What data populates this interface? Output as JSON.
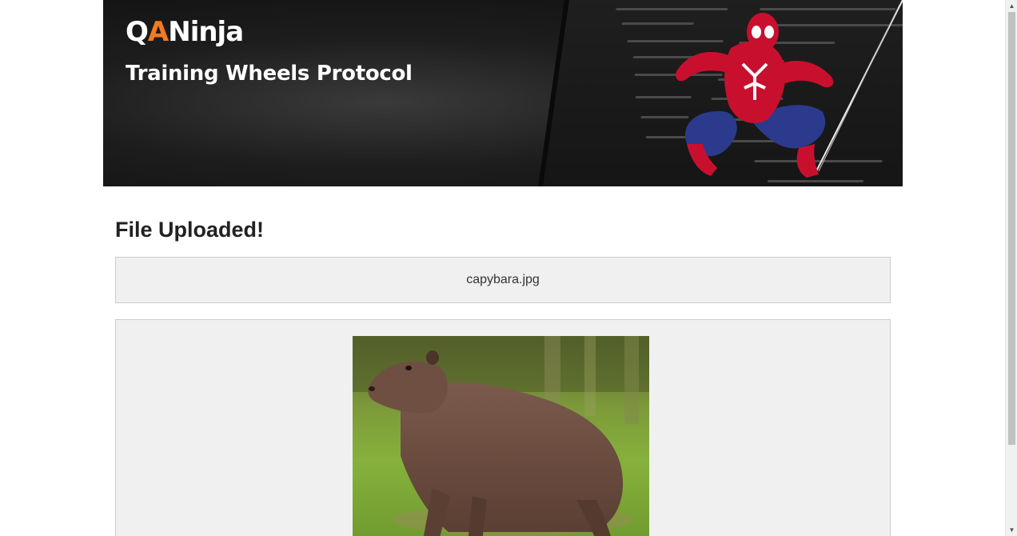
{
  "banner": {
    "logo_qa_q": "Q",
    "logo_qa_a": "A",
    "logo_ninja": "Ninja",
    "title": "Training Wheels Protocol",
    "accent_color": "#f47a1f"
  },
  "main": {
    "heading": "File Uploaded!",
    "uploaded_file_name": "capybara.jpg"
  },
  "icons": {
    "scroll_up": "scroll-up-arrow-icon",
    "scroll_down": "scroll-down-arrow-icon"
  }
}
